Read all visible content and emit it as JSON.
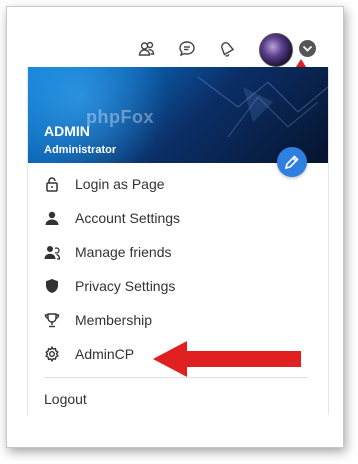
{
  "header": {
    "icons": [
      "friends-icon",
      "chat-icon",
      "notification-bell-icon"
    ],
    "avatar": "user-avatar",
    "menu_toggle": "chevron-down-icon"
  },
  "profile": {
    "brand": "phpFox",
    "name": "ADMIN",
    "role": "Administrator",
    "edit_icon": "pencil-icon"
  },
  "menu": {
    "items": [
      {
        "label": "Login as Page",
        "icon": "lock-icon"
      },
      {
        "label": "Account Settings",
        "icon": "user-icon"
      },
      {
        "label": "Manage friends",
        "icon": "users-icon"
      },
      {
        "label": "Privacy Settings",
        "icon": "shield-icon"
      },
      {
        "label": "Membership",
        "icon": "trophy-icon"
      },
      {
        "label": "AdminCP",
        "icon": "gear-icon"
      }
    ],
    "logout_label": "Logout"
  },
  "colors": {
    "annotation_arrow": "#e02020",
    "accent": "#2f7fe0",
    "text": "#333333"
  }
}
